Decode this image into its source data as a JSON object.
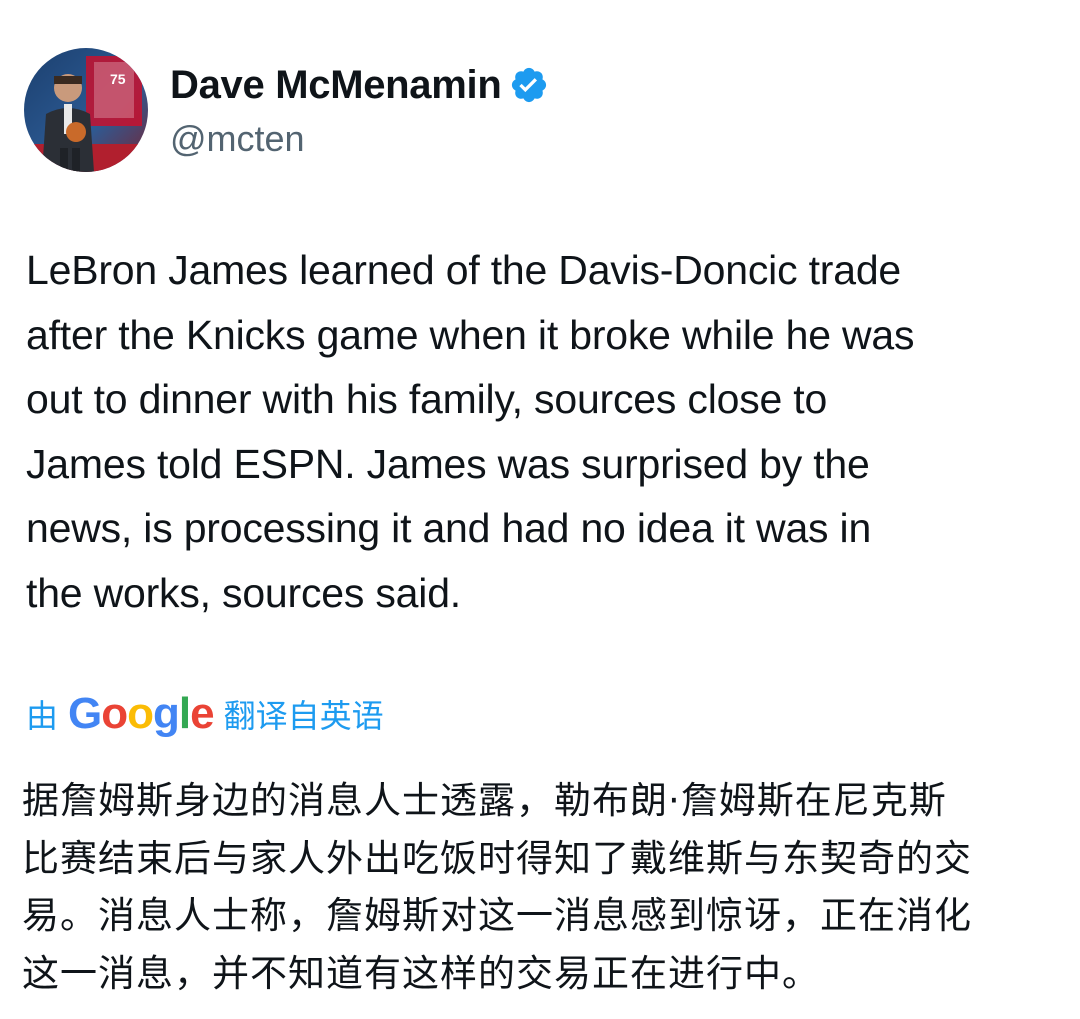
{
  "author": {
    "display_name": "Dave McMenamin",
    "handle": "@mcten",
    "verified_icon": "verified-badge-icon",
    "avatar_icon": "profile-photo",
    "avatar_badge_text": "75"
  },
  "tweet": {
    "text": "LeBron James learned of the Davis-Doncic trade\nafter the Knicks game when it broke while he was\nout to dinner with his family, sources close to\nJames told ESPN. James was surprised by the\nnews, is processing it and had no idea it was in\nthe works, sources said."
  },
  "translation": {
    "prefix": "由",
    "provider_logo": {
      "letters": [
        "G",
        "o",
        "o",
        "g",
        "l",
        "e"
      ],
      "colors": [
        "#4285f4",
        "#ea4335",
        "#fbbc05",
        "#4285f4",
        "#34a853",
        "#ea4335"
      ]
    },
    "suffix": "翻译自英语",
    "text": "据詹姆斯身边的消息人士透露，勒布朗·詹姆斯在尼克斯\n比赛结束后与家人外出吃饭时得知了戴维斯与东契奇的交\n易。消息人士称，詹姆斯对这一消息感到惊讶，正在消化\n这一消息，并不知道有这样的交易正在进行中。"
  },
  "colors": {
    "text": "#0f1419",
    "secondary": "#536471",
    "link": "#1d9bf0",
    "verified": "#1d9bf0"
  }
}
